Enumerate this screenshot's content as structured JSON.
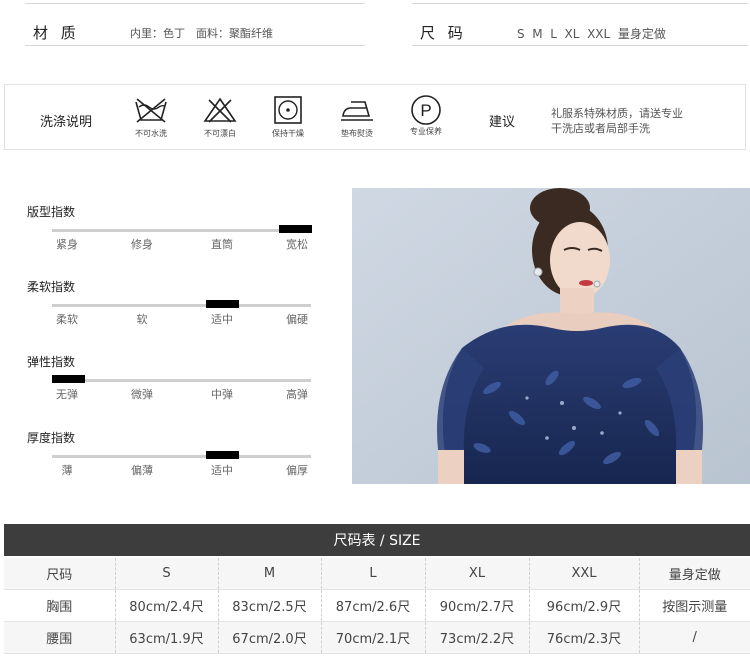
{
  "info": {
    "material_label": "材 质",
    "material_value": "内里：色丁　面料：聚酯纤维",
    "size_label": "尺 码",
    "size_value": "S  M  L  XL  XXL  量身定做"
  },
  "care": {
    "title": "洗涤说明",
    "items": [
      {
        "icon": "no-water-wash-icon",
        "caption": "不可水洗"
      },
      {
        "icon": "no-bleach-icon",
        "caption": "不可漂白"
      },
      {
        "icon": "tumble-dry-icon",
        "caption": "保持干燥"
      },
      {
        "icon": "iron-with-cloth-icon",
        "caption": "垫布熨烫"
      },
      {
        "icon": "professional-care-icon",
        "caption": "专业保养"
      }
    ],
    "professional_letter": "P",
    "suggest_label": "建议",
    "suggest_text_1": "礼服系特殊材质，请送专业",
    "suggest_text_2": "干洗店或者局部手洗"
  },
  "indexes": [
    {
      "title": "版型指数",
      "labels": [
        "紧身",
        "修身",
        "直筒",
        "宽松"
      ],
      "level": 4
    },
    {
      "title": "柔软指数",
      "labels": [
        "柔软",
        "软",
        "适中",
        "偏硬"
      ],
      "level": 3
    },
    {
      "title": "弹性指数",
      "labels": [
        "无弹",
        "微弹",
        "中弹",
        "高弹"
      ],
      "level": 1
    },
    {
      "title": "厚度指数",
      "labels": [
        "薄",
        "偏薄",
        "适中",
        "偏厚"
      ],
      "level": 3
    }
  ],
  "size_table": {
    "title": "尺码表 / SIZE",
    "rows": [
      [
        "尺码",
        "S",
        "M",
        "L",
        "XL",
        "XXL",
        "量身定做"
      ],
      [
        "胸围",
        "80cm/2.4尺",
        "83cm/2.5尺",
        "87cm/2.6尺",
        "90cm/2.7尺",
        "96cm/2.9尺",
        "按图示测量"
      ],
      [
        "腰围",
        "63cm/1.9尺",
        "67cm/2.0尺",
        "70cm/2.1尺",
        "73cm/2.2尺",
        "76cm/2.3尺",
        "/"
      ]
    ]
  },
  "colors": {
    "header_bg": "#3d3d3d",
    "dress_navy": "#1f3368",
    "photo_bg": "#c9d3df"
  }
}
